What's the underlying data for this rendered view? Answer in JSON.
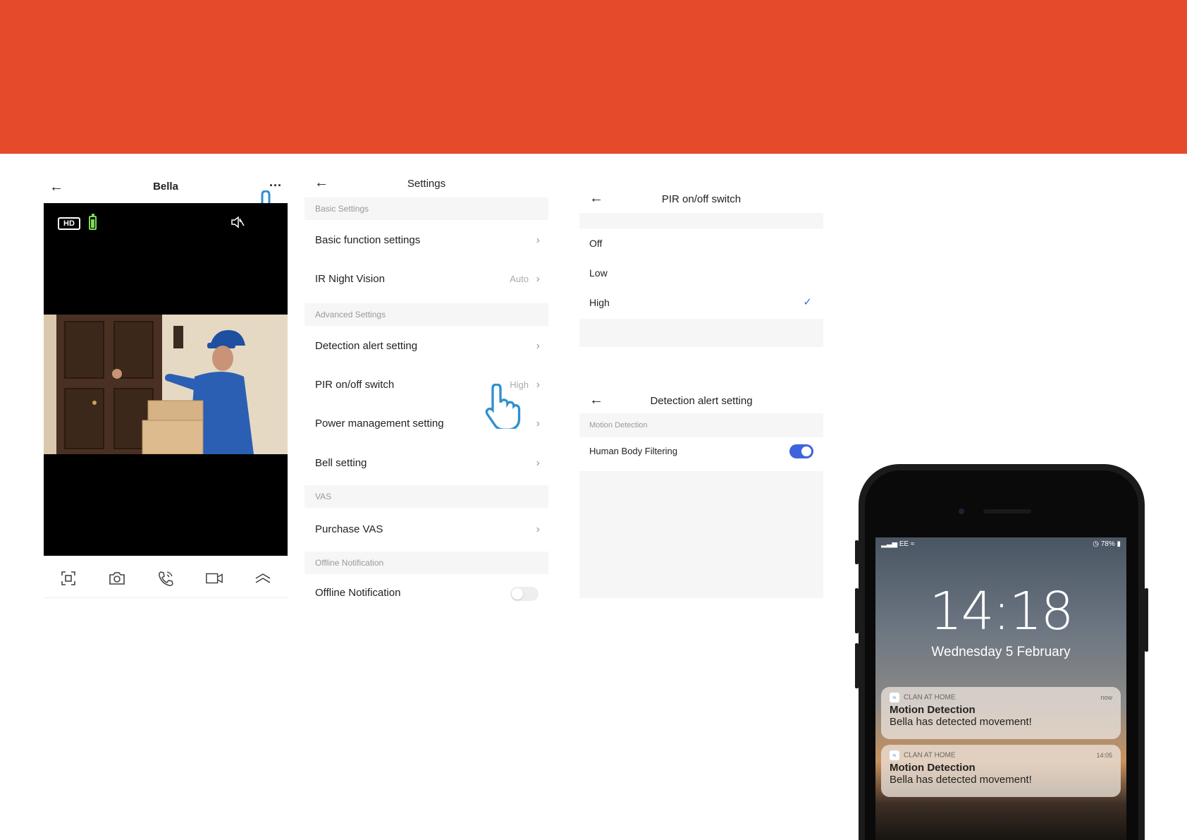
{
  "colors": {
    "brand": "#e54b2a",
    "accent": "#3e64dd",
    "check": "#3b6cdc"
  },
  "live": {
    "title": "Bella",
    "more": "...",
    "hd": "HD",
    "controls": [
      "screenshot-icon",
      "camera-icon",
      "call-icon",
      "video-record-icon",
      "expand-up-icon"
    ]
  },
  "settings": {
    "title": "Settings",
    "sections": {
      "basic": "Basic Settings",
      "advanced": "Advanced Settings",
      "vas": "VAS",
      "offline": "Offline Notification"
    },
    "rows": {
      "basic_function": "Basic function settings",
      "ir_night": "IR Night Vision",
      "ir_value": "Auto",
      "detection": "Detection alert setting",
      "pir": "PIR on/off switch",
      "pir_value": "High",
      "power": "Power management setting",
      "bell": "Bell setting",
      "purchase": "Purchase VAS",
      "offline": "Offline Notification"
    }
  },
  "pir": {
    "title": "PIR on/off switch",
    "options": [
      "Off",
      "Low",
      "High"
    ],
    "selected": "High"
  },
  "detection": {
    "title": "Detection alert setting",
    "section": "Motion Detection",
    "filter_label": "Human Body Filtering"
  },
  "phone": {
    "carrier": "EE",
    "battery": "78%",
    "time": "14:18",
    "date": "Wednesday 5 February",
    "notifications": [
      {
        "app": "CLAN AT HOME",
        "when": "now",
        "title": "Motion Detection",
        "body": "Bella has detected movement!"
      },
      {
        "app": "CLAN AT HOME",
        "when": "14:05",
        "title": "Motion Detection",
        "body": "Bella has detected movement!"
      }
    ]
  }
}
